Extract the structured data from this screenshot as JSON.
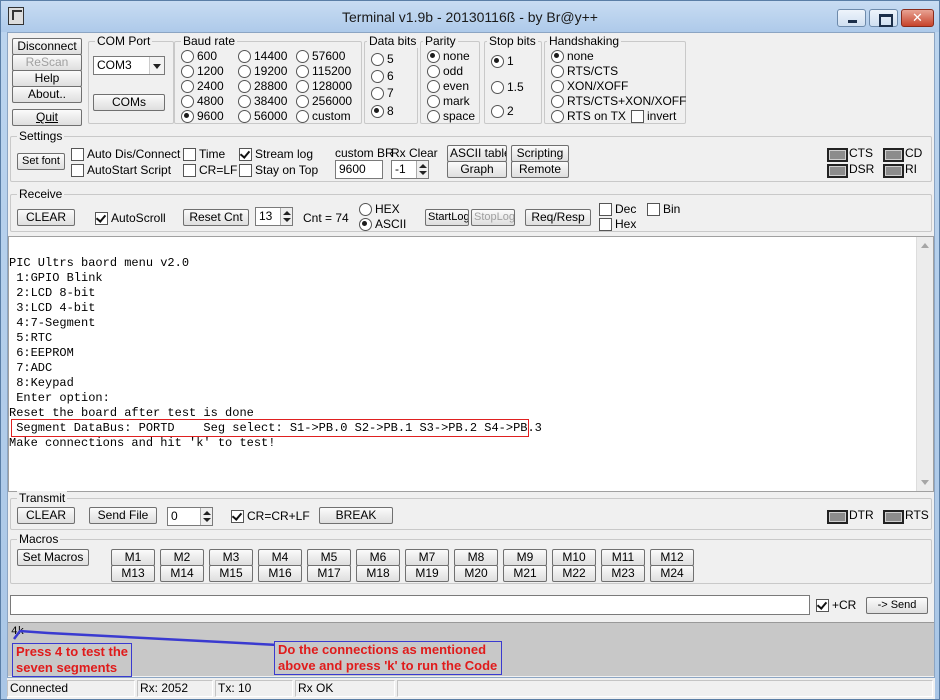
{
  "window": {
    "title": "Terminal v1.9b - 20130116ß - by Br@y++",
    "close_glyph": "✕"
  },
  "left_buttons": {
    "disconnect": "Disconnect",
    "rescan": "ReScan",
    "help": "Help",
    "about": "About..",
    "quit": "Quit"
  },
  "com_port": {
    "label": "COM Port",
    "selected": "COM3",
    "coms_button": "COMs"
  },
  "baud_rate": {
    "label": "Baud rate",
    "options": [
      "600",
      "1200",
      "2400",
      "4800",
      "9600",
      "14400",
      "19200",
      "28800",
      "38400",
      "56000",
      "57600",
      "115200",
      "128000",
      "256000",
      "custom"
    ],
    "selected": "9600"
  },
  "data_bits": {
    "label": "Data bits",
    "options": [
      "5",
      "6",
      "7",
      "8"
    ],
    "selected": "8"
  },
  "parity": {
    "label": "Parity",
    "options": [
      "none",
      "odd",
      "even",
      "mark",
      "space"
    ],
    "selected": "none"
  },
  "stop_bits": {
    "label": "Stop bits",
    "options": [
      "1",
      "1.5",
      "2"
    ],
    "selected": "1"
  },
  "handshaking": {
    "label": "Handshaking",
    "options": [
      "none",
      "RTS/CTS",
      "XON/XOFF",
      "RTS/CTS+XON/XOFF",
      "RTS on TX"
    ],
    "invert_label": "invert",
    "selected": "none"
  },
  "settings": {
    "label": "Settings",
    "set_font": "Set font",
    "auto_dis_connect": "Auto Dis/Connect",
    "autostart_script": "AutoStart Script",
    "time": "Time",
    "cr_lf": "CR=LF",
    "stream_log": "Stream log",
    "stay_on_top": "Stay on Top",
    "custom_br_label": "custom BR",
    "custom_br_value": "9600",
    "rx_clear_label": "Rx Clear",
    "rx_clear_value": "-1",
    "ascii_table": "ASCII table",
    "scripting": "Scripting",
    "graph": "Graph",
    "remote": "Remote",
    "leds": [
      "CTS",
      "CD",
      "DSR",
      "RI"
    ]
  },
  "receive": {
    "label": "Receive",
    "clear": "CLEAR",
    "autoscroll": "AutoScroll",
    "reset_cnt": "Reset Cnt",
    "cnt_spin": "13",
    "cnt_label": "Cnt =  74",
    "hex": "HEX",
    "ascii": "ASCII",
    "startlog": "StartLog",
    "stoplog": "StopLog",
    "req_resp": "Req/Resp",
    "dec": "Dec",
    "hex_chk": "Hex",
    "bin": "Bin"
  },
  "terminal_lines": [
    "PIC Ultrs baord menu v2.0",
    " 1:GPIO Blink",
    " 2:LCD 8-bit",
    " 3:LCD 4-bit",
    " 4:7-Segment",
    " 5:RTC",
    " 6:EEPROM",
    " 7:ADC",
    " 8:Keypad",
    " Enter option:",
    "Reset the board after test is done",
    " Segment DataBus: PORTD    Seg select: S1->PB.0 S2->PB.1 S3->PB.2 S4->PB.3",
    "Make connections and hit 'k' to test!"
  ],
  "transmit": {
    "label": "Transmit",
    "clear": "CLEAR",
    "send_file": "Send File",
    "spin_value": "0",
    "cr_crlf": "CR=CR+LF",
    "break": "BREAK",
    "leds": [
      "DTR",
      "RTS"
    ]
  },
  "macros": {
    "label": "Macros",
    "set_macros": "Set Macros",
    "row1": [
      "M1",
      "M2",
      "M3",
      "M4",
      "M5",
      "M6",
      "M7",
      "M8",
      "M9",
      "M10",
      "M11",
      "M12"
    ],
    "row2": [
      "M13",
      "M14",
      "M15",
      "M16",
      "M17",
      "M18",
      "M19",
      "M20",
      "M21",
      "M22",
      "M23",
      "M24"
    ]
  },
  "send_bar": {
    "input_value": "",
    "plus_cr": "+CR",
    "send": "-> Send"
  },
  "echo": {
    "text": "4k",
    "annotation_left": [
      "Press 4 to test the",
      "seven segments"
    ],
    "annotation_right": [
      "Do the connections as mentioned",
      "above and press 'k' to run the Code"
    ],
    "annotation_color": "#e01b1b",
    "arrow_color": "#3a3ad0"
  },
  "status": {
    "connection": "Connected",
    "rx": "Rx: 2052",
    "tx": "Tx: 10",
    "rx_ok": "Rx OK"
  }
}
